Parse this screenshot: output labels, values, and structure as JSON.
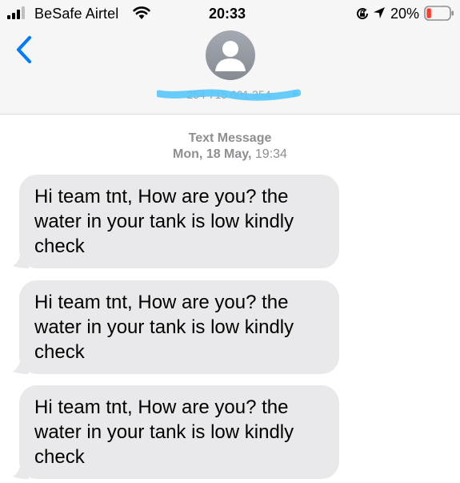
{
  "status_bar": {
    "carrier": "BeSafe Airtel",
    "time": "20:33",
    "battery_percent": "20%",
    "battery_level": 0.2,
    "icons": [
      "signal-bars-icon",
      "wifi-icon",
      "rotation-lock-icon",
      "location-arrow-icon",
      "battery-icon"
    ]
  },
  "header": {
    "back_icon": "chevron-left-icon",
    "contact_name": "254 715 601 354",
    "avatar_icon": "person-silhouette-icon"
  },
  "thread_meta": {
    "label": "Text Message",
    "date": "Mon, 18 May,",
    "time": "19:34"
  },
  "messages": [
    {
      "text": "Hi team tnt, How are you? the water in your tank is low kindly check"
    },
    {
      "text": "Hi team tnt, How are you? the water in your tank is low kindly check"
    },
    {
      "text": "Hi team tnt, How are you? the water in your tank is low kindly check"
    }
  ],
  "colors": {
    "accent": "#007aff",
    "header_bg": "#f6f6f6",
    "bubble_bg": "#e9e9eb",
    "meta_text": "#8e8e93",
    "battery_low": "#ff3b30",
    "redaction": "#5ac8fa"
  }
}
